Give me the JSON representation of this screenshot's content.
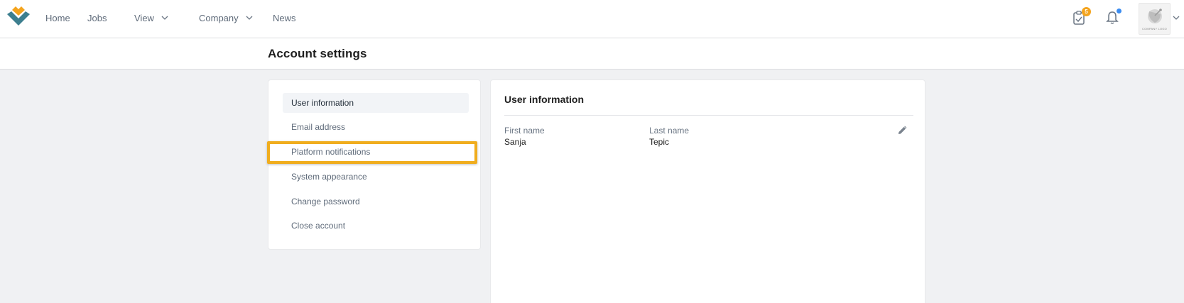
{
  "nav": {
    "items": [
      {
        "label": "Home"
      },
      {
        "label": "Jobs"
      },
      {
        "label": "View"
      },
      {
        "label": "Company"
      },
      {
        "label": "News"
      }
    ],
    "task_badge": "5",
    "company_logo_text": "COMPANY LOGO",
    "icons": {
      "logo": "brand-logo-icon",
      "tasks": "clipboard-check-icon",
      "notifications": "bell-icon",
      "chevron": "chevron-down-icon",
      "edit": "pencil-icon"
    },
    "colors": {
      "badge": "#f4a41d",
      "notification_dot": "#3b8cf0",
      "highlight": "#f0ad1e",
      "logo_orange": "#f4a41d",
      "logo_teal": "#3d7f8f"
    }
  },
  "page": {
    "title": "Account settings"
  },
  "menu": {
    "items": [
      {
        "label": "User information"
      },
      {
        "label": "Email address"
      },
      {
        "label": "Platform notifications"
      },
      {
        "label": "System appearance"
      },
      {
        "label": "Change password"
      },
      {
        "label": "Close account"
      }
    ]
  },
  "user_info": {
    "title": "User information",
    "first_name_label": "First name",
    "first_name_value": "Sanja",
    "last_name_label": "Last name",
    "last_name_value": "Tepic"
  }
}
